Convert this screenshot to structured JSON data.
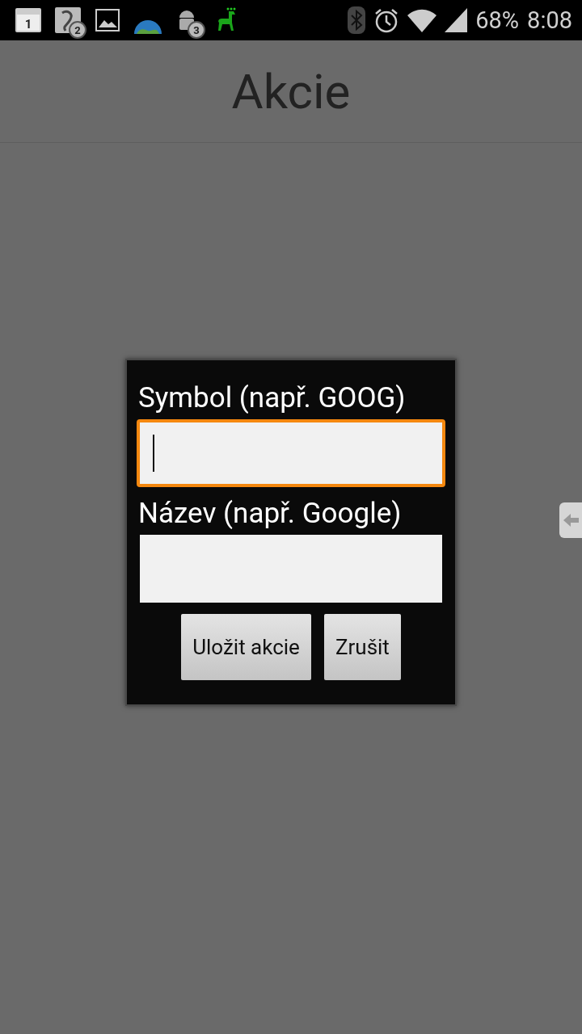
{
  "status_bar": {
    "notifications": [
      {
        "kind": "calendar",
        "badge": "1"
      },
      {
        "kind": "app",
        "badge": "2"
      },
      {
        "kind": "gallery"
      },
      {
        "kind": "globe"
      },
      {
        "kind": "android",
        "badge": "3"
      },
      {
        "kind": "llama"
      }
    ],
    "battery": "68%",
    "time": "8:08"
  },
  "title": "Akcie",
  "dialog": {
    "fields": [
      {
        "label": "Symbol (např. GOOG)",
        "focused": true
      },
      {
        "label": "Název (např. Google)",
        "focused": false
      }
    ],
    "buttons": [
      "Uložit akcie",
      "Zrušit"
    ]
  }
}
